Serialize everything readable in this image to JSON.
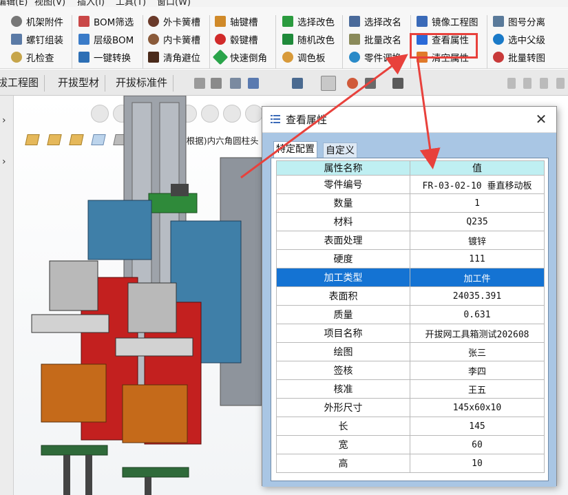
{
  "menu": {
    "items": [
      "编辑(E)",
      "视图(V)",
      "插入(I)",
      "工具(T)",
      "窗口(W)"
    ]
  },
  "ribbon": {
    "col1": [
      {
        "label": "机架附件",
        "icon": "gear-icon",
        "color": "#666666"
      },
      {
        "label": "螺钉组装",
        "icon": "screw-icon",
        "color": "#5a7aa6"
      },
      {
        "label": "孔检查",
        "icon": "magnifier-icon",
        "color": "#c6a54b"
      }
    ],
    "col2": [
      {
        "label": "BOM筛选",
        "icon": "table-icon",
        "color": "#c94747"
      },
      {
        "label": "层级BOM",
        "icon": "hierarchy-icon",
        "color": "#3a7bc8"
      },
      {
        "label": "一键转换",
        "icon": "save-icon",
        "color": "#2d6fb5"
      }
    ],
    "col3": [
      {
        "label": "外卡簧槽",
        "icon": "ring-icon",
        "color": "#6a3a2a"
      },
      {
        "label": "内卡簧槽",
        "icon": "ring-icon",
        "color": "#8a5a3a"
      },
      {
        "label": "清角避位",
        "icon": "corner-icon",
        "color": "#4a2a1a"
      }
    ],
    "col4": [
      {
        "label": "轴键槽",
        "icon": "key-icon",
        "color": "#d08a2a"
      },
      {
        "label": "毂键槽",
        "icon": "hub-icon",
        "color": "#d12b2b"
      },
      {
        "label": "快速倒角",
        "icon": "chamfer-icon",
        "color": "#2aa44a"
      }
    ],
    "col5": [
      {
        "label": "选择改色",
        "icon": "color-select-icon",
        "color": "#2b9b3f"
      },
      {
        "label": "随机改色",
        "icon": "random-color-icon",
        "color": "#1f8a3a"
      },
      {
        "label": "调色板",
        "icon": "palette-icon",
        "color": "#d89a3a"
      }
    ],
    "col6": [
      {
        "label": "选择改名",
        "icon": "rename-icon",
        "color": "#4a6a9a"
      },
      {
        "label": "批量改名",
        "icon": "batch-rename-icon",
        "color": "#8a8a5a"
      },
      {
        "label": "零件调换",
        "icon": "swap-icon",
        "color": "#2a8ac8"
      }
    ],
    "col7": [
      {
        "label": "镜像工程图",
        "icon": "mirror-icon",
        "color": "#3a6ab8"
      },
      {
        "label": "查看属性",
        "icon": "properties-icon",
        "color": "#2a6ad8"
      },
      {
        "label": "清空属性",
        "icon": "clear-properties-icon",
        "color": "#e07a2a"
      }
    ],
    "col8": [
      {
        "label": "图号分离",
        "icon": "split-icon",
        "color": "#5a7a9a"
      },
      {
        "label": "选中父级",
        "icon": "cloud-icon",
        "color": "#1a7ac8"
      },
      {
        "label": "批量转图",
        "icon": "convert-icon",
        "color": "#c83a3a"
      }
    ]
  },
  "command_tabs": [
    "拔工程图",
    "开拔型材",
    "开拔标准件"
  ],
  "left_panel": {
    "arrow1": "›",
    "arrow2": "›"
  },
  "feature_manager": {
    "label": "打孔尺寸(%根据)内六角圆柱头"
  },
  "dialog": {
    "title": "查看属性",
    "close": "✕",
    "tabs": [
      "特定配置",
      "自定义"
    ],
    "headers": [
      "属性名称",
      "值"
    ],
    "rows": [
      {
        "name": "零件编号",
        "value": "FR-03-02-10 垂直移动板"
      },
      {
        "name": "数量",
        "value": "1"
      },
      {
        "name": "材料",
        "value": "Q235"
      },
      {
        "name": "表面处理",
        "value": "镀锌"
      },
      {
        "name": "硬度",
        "value": "111"
      },
      {
        "name": "加工类型",
        "value": "加工件",
        "selected": true
      },
      {
        "name": "表面积",
        "value": "24035.391"
      },
      {
        "name": "质量",
        "value": "0.631"
      },
      {
        "name": "项目名称",
        "value": "开拔网工具箱测试202608"
      },
      {
        "name": "绘图",
        "value": "张三"
      },
      {
        "name": "签核",
        "value": "李四"
      },
      {
        "name": "核准",
        "value": "王五"
      },
      {
        "name": "外形尺寸",
        "value": "145x60x10"
      },
      {
        "name": "长",
        "value": "145"
      },
      {
        "name": "宽",
        "value": "60"
      },
      {
        "name": "高",
        "value": "10"
      }
    ]
  },
  "colors": {
    "highlight": "#e8413c",
    "selection": "#1473d3",
    "header_bg": "#bfeff2",
    "dialog_body": "#a9c6e4"
  }
}
